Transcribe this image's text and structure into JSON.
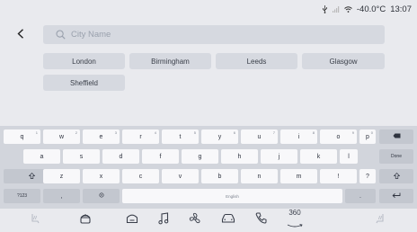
{
  "status": {
    "temperature": "-40.0°C",
    "time": "13:07"
  },
  "search": {
    "placeholder": "City Name",
    "value": ""
  },
  "suggestions": [
    {
      "label": "London"
    },
    {
      "label": "Birmingham"
    },
    {
      "label": "Leeds"
    },
    {
      "label": "Glasgow"
    },
    {
      "label": "Sheffield"
    }
  ],
  "keyboard": {
    "row1": [
      {
        "label": "q",
        "hint": "1"
      },
      {
        "label": "w",
        "hint": "2"
      },
      {
        "label": "e",
        "hint": "3"
      },
      {
        "label": "r",
        "hint": "4"
      },
      {
        "label": "t",
        "hint": "5"
      },
      {
        "label": "y",
        "hint": "6"
      },
      {
        "label": "u",
        "hint": "7"
      },
      {
        "label": "i",
        "hint": "8"
      },
      {
        "label": "o",
        "hint": "9"
      },
      {
        "label": "p",
        "hint": "0"
      }
    ],
    "row2": [
      "a",
      "s",
      "d",
      "f",
      "g",
      "h",
      "j",
      "k",
      "l"
    ],
    "done_label": "Done",
    "row3": [
      "z",
      "x",
      "c",
      "v",
      "b",
      "n",
      "m",
      "!",
      "?"
    ],
    "symbols_label": "?123",
    "comma_label": ",",
    "space_label": "English",
    "period_label": "."
  },
  "dock": {
    "distance_label": "360"
  }
}
